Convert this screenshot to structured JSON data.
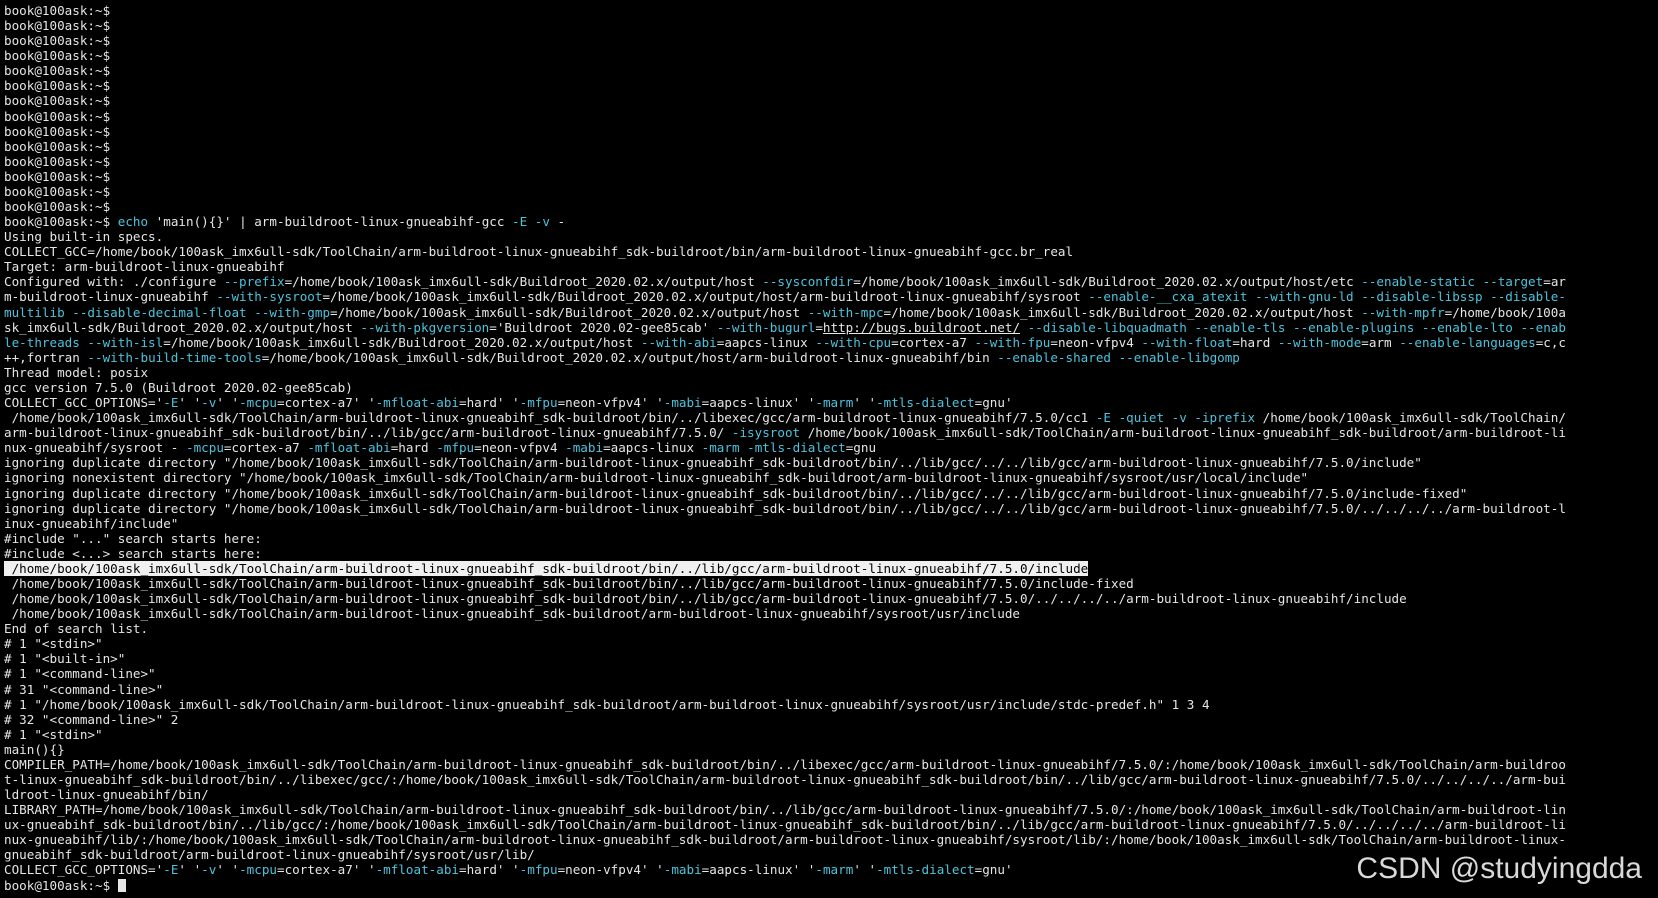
{
  "terminal": {
    "colors": {
      "background": "#000000",
      "text": "#e6e6e6",
      "option": "#4cc3dc",
      "highlight": "#f0f0f0"
    },
    "lines": [
      [
        {
          "t": "book@100ask:~$",
          "k": "c"
        }
      ],
      [
        {
          "t": "book@100ask:~$",
          "k": "c"
        }
      ],
      [
        {
          "t": "book@100ask:~$",
          "k": "c"
        }
      ],
      [
        {
          "t": "book@100ask:~$",
          "k": "c"
        }
      ],
      [
        {
          "t": "book@100ask:~$",
          "k": "c"
        }
      ],
      [
        {
          "t": "book@100ask:~$",
          "k": "c"
        }
      ],
      [
        {
          "t": "book@100ask:~$",
          "k": "c"
        }
      ],
      [
        {
          "t": "book@100ask:~$",
          "k": "c"
        }
      ],
      [
        {
          "t": "book@100ask:~$",
          "k": "c"
        }
      ],
      [
        {
          "t": "book@100ask:~$",
          "k": "c"
        }
      ],
      [
        {
          "t": "book@100ask:~$",
          "k": "c"
        }
      ],
      [
        {
          "t": "book@100ask:~$",
          "k": "c"
        }
      ],
      [
        {
          "t": "book@100ask:~$",
          "k": "c"
        }
      ],
      [
        {
          "t": "book@100ask:~$",
          "k": "c"
        }
      ],
      [
        {
          "t": "book@100ask:~$ ",
          "k": "c"
        },
        {
          "t": "echo",
          "k": "o"
        },
        {
          "t": " 'main(){}' | arm-buildroot-linux-gnueabihf-gcc ",
          "k": "c"
        },
        {
          "t": "-E",
          "k": "o"
        },
        {
          "t": " ",
          "k": "c"
        },
        {
          "t": "-v",
          "k": "o"
        },
        {
          "t": " -",
          "k": "c"
        }
      ],
      [
        {
          "t": "Using built-in specs.",
          "k": "c"
        }
      ],
      [
        {
          "t": "COLLECT_GCC=/home/book/100ask_imx6ull-sdk/ToolChain/arm-buildroot-linux-gnueabihf_sdk-buildroot/bin/arm-buildroot-linux-gnueabihf-gcc.br_real",
          "k": "c"
        }
      ],
      [
        {
          "t": "Target: arm-buildroot-linux-gnueabihf",
          "k": "c"
        }
      ],
      [
        {
          "t": "Configured with: ./configure ",
          "k": "c"
        },
        {
          "t": "--prefix",
          "k": "o"
        },
        {
          "t": "=/home/book/100ask_imx6ull-sdk/Buildroot_2020.02.x/output/host ",
          "k": "c"
        },
        {
          "t": "--sysconfdir",
          "k": "o"
        },
        {
          "t": "=/home/book/100ask_imx6ull-sdk/Buildroot_2020.02.x/output/host/etc ",
          "k": "c"
        },
        {
          "t": "--enable-static",
          "k": "o"
        },
        {
          "t": " ",
          "k": "c"
        },
        {
          "t": "--target",
          "k": "o"
        },
        {
          "t": "=ar",
          "k": "c"
        }
      ],
      [
        {
          "t": "m-buildroot-linux-gnueabihf ",
          "k": "c"
        },
        {
          "t": "--with-sysroot",
          "k": "o"
        },
        {
          "t": "=/home/book/100ask_imx6ull-sdk/Buildroot_2020.02.x/output/host/arm-buildroot-linux-gnueabihf/sysroot ",
          "k": "c"
        },
        {
          "t": "--enable-__cxa_atexit --with-gnu-ld --disable-libssp --disable-",
          "k": "o"
        }
      ],
      [
        {
          "t": "multilib --disable-decimal-float --with-gmp",
          "k": "o"
        },
        {
          "t": "=/home/book/100ask_imx6ull-sdk/Buildroot_2020.02.x/output/host ",
          "k": "c"
        },
        {
          "t": "--with-mpc",
          "k": "o"
        },
        {
          "t": "=/home/book/100ask_imx6ull-sdk/Buildroot_2020.02.x/output/host ",
          "k": "c"
        },
        {
          "t": "--with-mpfr",
          "k": "o"
        },
        {
          "t": "=/home/book/100a",
          "k": "c"
        }
      ],
      [
        {
          "t": "sk_imx6ull-sdk/Buildroot_2020.02.x/output/host ",
          "k": "c"
        },
        {
          "t": "--with-pkgversion",
          "k": "o"
        },
        {
          "t": "='Buildroot 2020.02-gee85cab' ",
          "k": "c"
        },
        {
          "t": "--with-bugurl",
          "k": "o"
        },
        {
          "t": "=",
          "k": "c"
        },
        {
          "t": "http://bugs.buildroot.net/",
          "k": "u"
        },
        {
          "t": " ",
          "k": "c"
        },
        {
          "t": "--disable-libquadmath --enable-tls --enable-plugins --enable-lto --enab",
          "k": "o"
        }
      ],
      [
        {
          "t": "le-threads --with-isl",
          "k": "o"
        },
        {
          "t": "=/home/book/100ask_imx6ull-sdk/Buildroot_2020.02.x/output/host ",
          "k": "c"
        },
        {
          "t": "--with-abi",
          "k": "o"
        },
        {
          "t": "=aapcs-linux ",
          "k": "c"
        },
        {
          "t": "--with-cpu",
          "k": "o"
        },
        {
          "t": "=cortex-a7 ",
          "k": "c"
        },
        {
          "t": "--with-fpu",
          "k": "o"
        },
        {
          "t": "=neon-vfpv4 ",
          "k": "c"
        },
        {
          "t": "--with-float",
          "k": "o"
        },
        {
          "t": "=hard ",
          "k": "c"
        },
        {
          "t": "--with-mode",
          "k": "o"
        },
        {
          "t": "=arm ",
          "k": "c"
        },
        {
          "t": "--enable-languages",
          "k": "o"
        },
        {
          "t": "=c,c",
          "k": "c"
        }
      ],
      [
        {
          "t": "++,fortran ",
          "k": "c"
        },
        {
          "t": "--with-build-time-tools",
          "k": "o"
        },
        {
          "t": "=/home/book/100ask_imx6ull-sdk/Buildroot_2020.02.x/output/host/arm-buildroot-linux-gnueabihf/bin ",
          "k": "c"
        },
        {
          "t": "--enable-shared --enable-libgomp",
          "k": "o"
        }
      ],
      [
        {
          "t": "Thread model: posix",
          "k": "c"
        }
      ],
      [
        {
          "t": "gcc version 7.5.0 (Buildroot 2020.02-gee85cab)",
          "k": "c"
        }
      ],
      [
        {
          "t": "COLLECT_GCC_OPTIONS='",
          "k": "c"
        },
        {
          "t": "-E",
          "k": "o"
        },
        {
          "t": "' '",
          "k": "c"
        },
        {
          "t": "-v",
          "k": "o"
        },
        {
          "t": "' '",
          "k": "c"
        },
        {
          "t": "-mcpu",
          "k": "o"
        },
        {
          "t": "=cortex-a7' '",
          "k": "c"
        },
        {
          "t": "-mfloat-abi",
          "k": "o"
        },
        {
          "t": "=hard' '",
          "k": "c"
        },
        {
          "t": "-mfpu",
          "k": "o"
        },
        {
          "t": "=neon-vfpv4' '",
          "k": "c"
        },
        {
          "t": "-mabi",
          "k": "o"
        },
        {
          "t": "=aapcs-linux' '",
          "k": "c"
        },
        {
          "t": "-marm",
          "k": "o"
        },
        {
          "t": "' '",
          "k": "c"
        },
        {
          "t": "-mtls-dialect",
          "k": "o"
        },
        {
          "t": "=gnu'",
          "k": "c"
        }
      ],
      [
        {
          "t": " /home/book/100ask_imx6ull-sdk/ToolChain/arm-buildroot-linux-gnueabihf_sdk-buildroot/bin/../libexec/gcc/arm-buildroot-linux-gnueabihf/7.5.0/cc1 ",
          "k": "c"
        },
        {
          "t": "-E -quiet -v -iprefix",
          "k": "o"
        },
        {
          "t": " /home/book/100ask_imx6ull-sdk/ToolChain/",
          "k": "c"
        }
      ],
      [
        {
          "t": "arm-buildroot-linux-gnueabihf_sdk-buildroot/bin/../lib/gcc/arm-buildroot-linux-gnueabihf/7.5.0/ ",
          "k": "c"
        },
        {
          "t": "-isysroot",
          "k": "o"
        },
        {
          "t": " /home/book/100ask_imx6ull-sdk/ToolChain/arm-buildroot-linux-gnueabihf_sdk-buildroot/arm-buildroot-li",
          "k": "c"
        }
      ],
      [
        {
          "t": "nux-gnueabihf/sysroot - ",
          "k": "c"
        },
        {
          "t": "-mcpu",
          "k": "o"
        },
        {
          "t": "=cortex-a7 ",
          "k": "c"
        },
        {
          "t": "-mfloat-abi",
          "k": "o"
        },
        {
          "t": "=hard ",
          "k": "c"
        },
        {
          "t": "-mfpu",
          "k": "o"
        },
        {
          "t": "=neon-vfpv4 ",
          "k": "c"
        },
        {
          "t": "-mabi",
          "k": "o"
        },
        {
          "t": "=aapcs-linux ",
          "k": "c"
        },
        {
          "t": "-marm -mtls-dialect",
          "k": "o"
        },
        {
          "t": "=gnu",
          "k": "c"
        }
      ],
      [
        {
          "t": "ignoring duplicate directory \"/home/book/100ask_imx6ull-sdk/ToolChain/arm-buildroot-linux-gnueabihf_sdk-buildroot/bin/../lib/gcc/../../lib/gcc/arm-buildroot-linux-gnueabihf/7.5.0/include\"",
          "k": "c"
        }
      ],
      [
        {
          "t": "ignoring nonexistent directory \"/home/book/100ask_imx6ull-sdk/ToolChain/arm-buildroot-linux-gnueabihf_sdk-buildroot/arm-buildroot-linux-gnueabihf/sysroot/usr/local/include\"",
          "k": "c"
        }
      ],
      [
        {
          "t": "ignoring duplicate directory \"/home/book/100ask_imx6ull-sdk/ToolChain/arm-buildroot-linux-gnueabihf_sdk-buildroot/bin/../lib/gcc/../../lib/gcc/arm-buildroot-linux-gnueabihf/7.5.0/include-fixed\"",
          "k": "c"
        }
      ],
      [
        {
          "t": "ignoring duplicate directory \"/home/book/100ask_imx6ull-sdk/ToolChain/arm-buildroot-linux-gnueabihf_sdk-buildroot/bin/../lib/gcc/../../lib/gcc/arm-buildroot-linux-gnueabihf/7.5.0/../../../../arm-buildroot-l",
          "k": "c"
        }
      ],
      [
        {
          "t": "inux-gnueabihf/include\"",
          "k": "c"
        }
      ],
      [
        {
          "t": "#include \"...\" search starts here:",
          "k": "c"
        }
      ],
      [
        {
          "t": "#include <...> search starts here:",
          "k": "c"
        }
      ],
      [
        {
          "t": " /home/book/100ask_imx6ull-sdk/ToolChain/arm-buildroot-linux-gnueabihf_sdk-buildroot/bin/../lib/gcc/arm-buildroot-linux-gnueabihf/7.5.0/include",
          "k": "h"
        }
      ],
      [
        {
          "t": " /home/book/100ask_imx6ull-sdk/ToolChain/arm-buildroot-linux-gnueabihf_sdk-buildroot/bin/../lib/gcc/arm-buildroot-linux-gnueabihf/7.5.0/include-fixed",
          "k": "c"
        }
      ],
      [
        {
          "t": " /home/book/100ask_imx6ull-sdk/ToolChain/arm-buildroot-linux-gnueabihf_sdk-buildroot/bin/../lib/gcc/arm-buildroot-linux-gnueabihf/7.5.0/../../../../arm-buildroot-linux-gnueabihf/include",
          "k": "c"
        }
      ],
      [
        {
          "t": " /home/book/100ask_imx6ull-sdk/ToolChain/arm-buildroot-linux-gnueabihf_sdk-buildroot/arm-buildroot-linux-gnueabihf/sysroot/usr/include",
          "k": "c"
        }
      ],
      [
        {
          "t": "End of search list.",
          "k": "c"
        }
      ],
      [
        {
          "t": "# 1 \"<stdin>\"",
          "k": "c"
        }
      ],
      [
        {
          "t": "# 1 \"<built-in>\"",
          "k": "c"
        }
      ],
      [
        {
          "t": "# 1 \"<command-line>\"",
          "k": "c"
        }
      ],
      [
        {
          "t": "# 31 \"<command-line>\"",
          "k": "c"
        }
      ],
      [
        {
          "t": "# 1 \"/home/book/100ask_imx6ull-sdk/ToolChain/arm-buildroot-linux-gnueabihf_sdk-buildroot/arm-buildroot-linux-gnueabihf/sysroot/usr/include/stdc-predef.h\" 1 3 4",
          "k": "c"
        }
      ],
      [
        {
          "t": "# 32 \"<command-line>\" 2",
          "k": "c"
        }
      ],
      [
        {
          "t": "# 1 \"<stdin>\"",
          "k": "c"
        }
      ],
      [
        {
          "t": "main(){}",
          "k": "c"
        }
      ],
      [
        {
          "t": "COMPILER_PATH=/home/book/100ask_imx6ull-sdk/ToolChain/arm-buildroot-linux-gnueabihf_sdk-buildroot/bin/../libexec/gcc/arm-buildroot-linux-gnueabihf/7.5.0/:/home/book/100ask_imx6ull-sdk/ToolChain/arm-buildroo",
          "k": "c"
        }
      ],
      [
        {
          "t": "t-linux-gnueabihf_sdk-buildroot/bin/../libexec/gcc/:/home/book/100ask_imx6ull-sdk/ToolChain/arm-buildroot-linux-gnueabihf_sdk-buildroot/bin/../lib/gcc/arm-buildroot-linux-gnueabihf/7.5.0/../../../../arm-bui",
          "k": "c"
        }
      ],
      [
        {
          "t": "ldroot-linux-gnueabihf/bin/",
          "k": "c"
        }
      ],
      [
        {
          "t": "LIBRARY_PATH=/home/book/100ask_imx6ull-sdk/ToolChain/arm-buildroot-linux-gnueabihf_sdk-buildroot/bin/../lib/gcc/arm-buildroot-linux-gnueabihf/7.5.0/:/home/book/100ask_imx6ull-sdk/ToolChain/arm-buildroot-lin",
          "k": "c"
        }
      ],
      [
        {
          "t": "ux-gnueabihf_sdk-buildroot/bin/../lib/gcc/:/home/book/100ask_imx6ull-sdk/ToolChain/arm-buildroot-linux-gnueabihf_sdk-buildroot/bin/../lib/gcc/arm-buildroot-linux-gnueabihf/7.5.0/../../../../arm-buildroot-li",
          "k": "c"
        }
      ],
      [
        {
          "t": "nux-gnueabihf/lib/:/home/book/100ask_imx6ull-sdk/ToolChain/arm-buildroot-linux-gnueabihf_sdk-buildroot/arm-buildroot-linux-gnueabihf/sysroot/lib/:/home/book/100ask_imx6ull-sdk/ToolChain/arm-buildroot-linux-",
          "k": "c"
        }
      ],
      [
        {
          "t": "gnueabihf_sdk-buildroot/arm-buildroot-linux-gnueabihf/sysroot/usr/lib/",
          "k": "c"
        }
      ],
      [
        {
          "t": "COLLECT_GCC_OPTIONS='",
          "k": "c"
        },
        {
          "t": "-E",
          "k": "o"
        },
        {
          "t": "' '",
          "k": "c"
        },
        {
          "t": "-v",
          "k": "o"
        },
        {
          "t": "' '",
          "k": "c"
        },
        {
          "t": "-mcpu",
          "k": "o"
        },
        {
          "t": "=cortex-a7' '",
          "k": "c"
        },
        {
          "t": "-mfloat-abi",
          "k": "o"
        },
        {
          "t": "=hard' '",
          "k": "c"
        },
        {
          "t": "-mfpu",
          "k": "o"
        },
        {
          "t": "=neon-vfpv4' '",
          "k": "c"
        },
        {
          "t": "-mabi",
          "k": "o"
        },
        {
          "t": "=aapcs-linux' '",
          "k": "c"
        },
        {
          "t": "-marm",
          "k": "o"
        },
        {
          "t": "' '",
          "k": "c"
        },
        {
          "t": "-mtls-dialect",
          "k": "o"
        },
        {
          "t": "=gnu'",
          "k": "c"
        }
      ],
      [
        {
          "t": "book@100ask:~$ ",
          "k": "c"
        }
      ]
    ]
  },
  "watermark": "CSDN @studyingdda"
}
